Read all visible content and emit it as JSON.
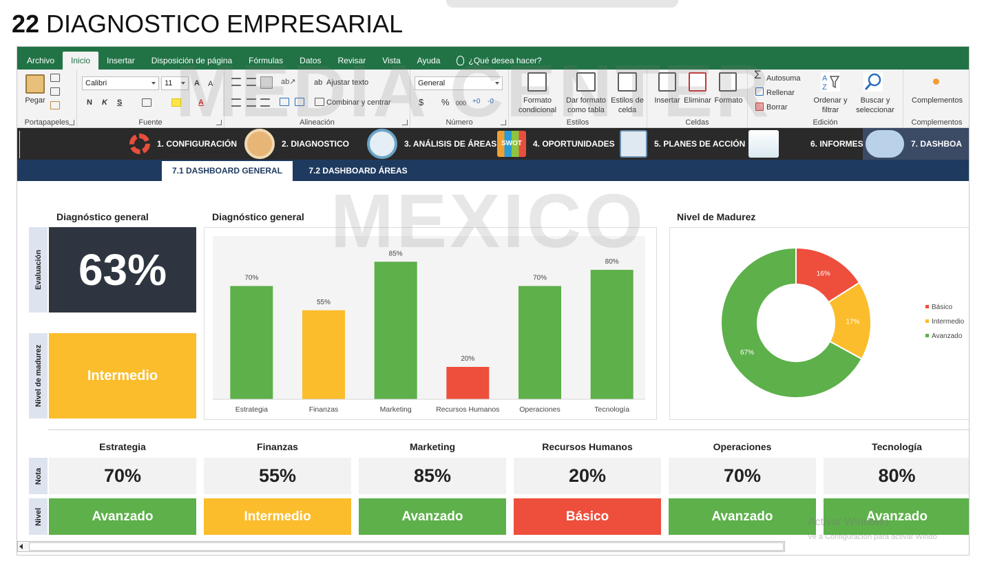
{
  "slide": {
    "number": "22",
    "title": "DIAGNOSTICO EMPRESARIAL"
  },
  "ribbon": {
    "tabs": [
      "Archivo",
      "Inicio",
      "Insertar",
      "Disposición de página",
      "Fórmulas",
      "Datos",
      "Revisar",
      "Vista",
      "Ayuda"
    ],
    "active_tab": "Inicio",
    "tell_me": "¿Qué desea hacer?",
    "clipboard": {
      "paste": "Pegar",
      "group": "Portapapeles"
    },
    "font": {
      "name": "Calibri",
      "size": "11",
      "bold": "N",
      "italic": "K",
      "underline": "S",
      "group": "Fuente"
    },
    "alignment": {
      "wrap": "Ajustar texto",
      "merge": "Combinar y centrar",
      "group": "Alineación"
    },
    "number": {
      "format": "General",
      "currency": "$",
      "percent": "%",
      "thousands": "000",
      "group": "Número"
    },
    "styles": {
      "conditional": "Formato\ncondicional",
      "as_table": "Dar formato\ncomo tabla",
      "cell_styles": "Estilos de\ncelda",
      "group": "Estilos"
    },
    "cells": {
      "insert": "Insertar",
      "delete": "Eliminar",
      "format": "Formato",
      "group": "Celdas"
    },
    "editing": {
      "autosum": "Autosuma",
      "fill": "Rellenar",
      "clear": "Borrar",
      "sort": "Ordenar y\nfiltrar",
      "find": "Buscar y\nseleccionar",
      "group": "Edición"
    },
    "addins": {
      "label": "Complementos",
      "group": "Complementos"
    }
  },
  "nav": {
    "items": [
      {
        "label": "1. CONFIGURACIÓN",
        "icon": "gear-icon"
      },
      {
        "label": "2. DIAGNOSTICO",
        "icon": "diagnosis-icon"
      },
      {
        "label": "3. ANÁLISIS DE ÁREAS",
        "icon": "magnifier-chart-icon"
      },
      {
        "label": "4. OPORTUNIDADES",
        "icon": "swot-icon",
        "icon_text": "SWOT"
      },
      {
        "label": "5. PLANES DE ACCIÓN",
        "icon": "action-plan-icon"
      },
      {
        "label": "6. INFORMES",
        "icon": "report-icon"
      },
      {
        "label": "7. DASHBOA",
        "icon": "dashboard-icon"
      }
    ],
    "subtabs": [
      "7.1 DASHBOARD GENERAL",
      "7.2 DASHBOARD ÁREAS"
    ],
    "active_subtab": "7.1 DASHBOARD GENERAL"
  },
  "dashboard": {
    "general_title": "Diagnóstico general",
    "evaluation_label": "Evaluación",
    "evaluation_value": "63%",
    "maturity_label": "Nivel de madurez",
    "maturity_value": "Intermedio",
    "chart_title": "Diagnóstico general",
    "donut_title": "Nivel de Madurez",
    "note_label": "Nota",
    "level_label": "Nivel",
    "areas": [
      {
        "name": "Estrategia",
        "score": "70%",
        "level": "Avanzado"
      },
      {
        "name": "Finanzas",
        "score": "55%",
        "level": "Intermedio"
      },
      {
        "name": "Marketing",
        "score": "85%",
        "level": "Avanzado"
      },
      {
        "name": "Recursos Humanos",
        "score": "20%",
        "level": "Básico"
      },
      {
        "name": "Operaciones",
        "score": "70%",
        "level": "Avanzado"
      },
      {
        "name": "Tecnología",
        "score": "80%",
        "level": "Avanzado"
      }
    ]
  },
  "colors": {
    "avanzado": "#5db04a",
    "intermedio": "#fbbd2c",
    "basico": "#ee4e3c",
    "excel_green": "#217346",
    "navy": "#1f3a5f"
  },
  "watermark": {
    "line1": "MEDIA CENTER",
    "line2": "MEXICO"
  },
  "os_notice": {
    "line1": "Activar Windows",
    "line2": "Ve a Configuración para activar Windo"
  },
  "chart_data": [
    {
      "type": "bar",
      "title": "Diagnóstico general",
      "categories": [
        "Estrategia",
        "Finanzas",
        "Marketing",
        "Recursos Humanos",
        "Operaciones",
        "Tecnología"
      ],
      "values": [
        70,
        55,
        85,
        20,
        70,
        80
      ],
      "value_labels": [
        "70%",
        "55%",
        "85%",
        "20%",
        "70%",
        "80%"
      ],
      "bar_colors": [
        "#5db04a",
        "#fbbd2c",
        "#5db04a",
        "#ee4e3c",
        "#5db04a",
        "#5db04a"
      ],
      "ylim": [
        0,
        100
      ],
      "grid": false
    },
    {
      "type": "pie",
      "variant": "donut",
      "title": "Nivel de Madurez",
      "labels": [
        "Básico",
        "Intermedio",
        "Avanzado"
      ],
      "values": [
        16,
        17,
        67
      ],
      "value_labels": [
        "16%",
        "17%",
        "67%"
      ],
      "colors": [
        "#ee4e3c",
        "#fbbd2c",
        "#5db04a"
      ],
      "legend": "right"
    }
  ]
}
